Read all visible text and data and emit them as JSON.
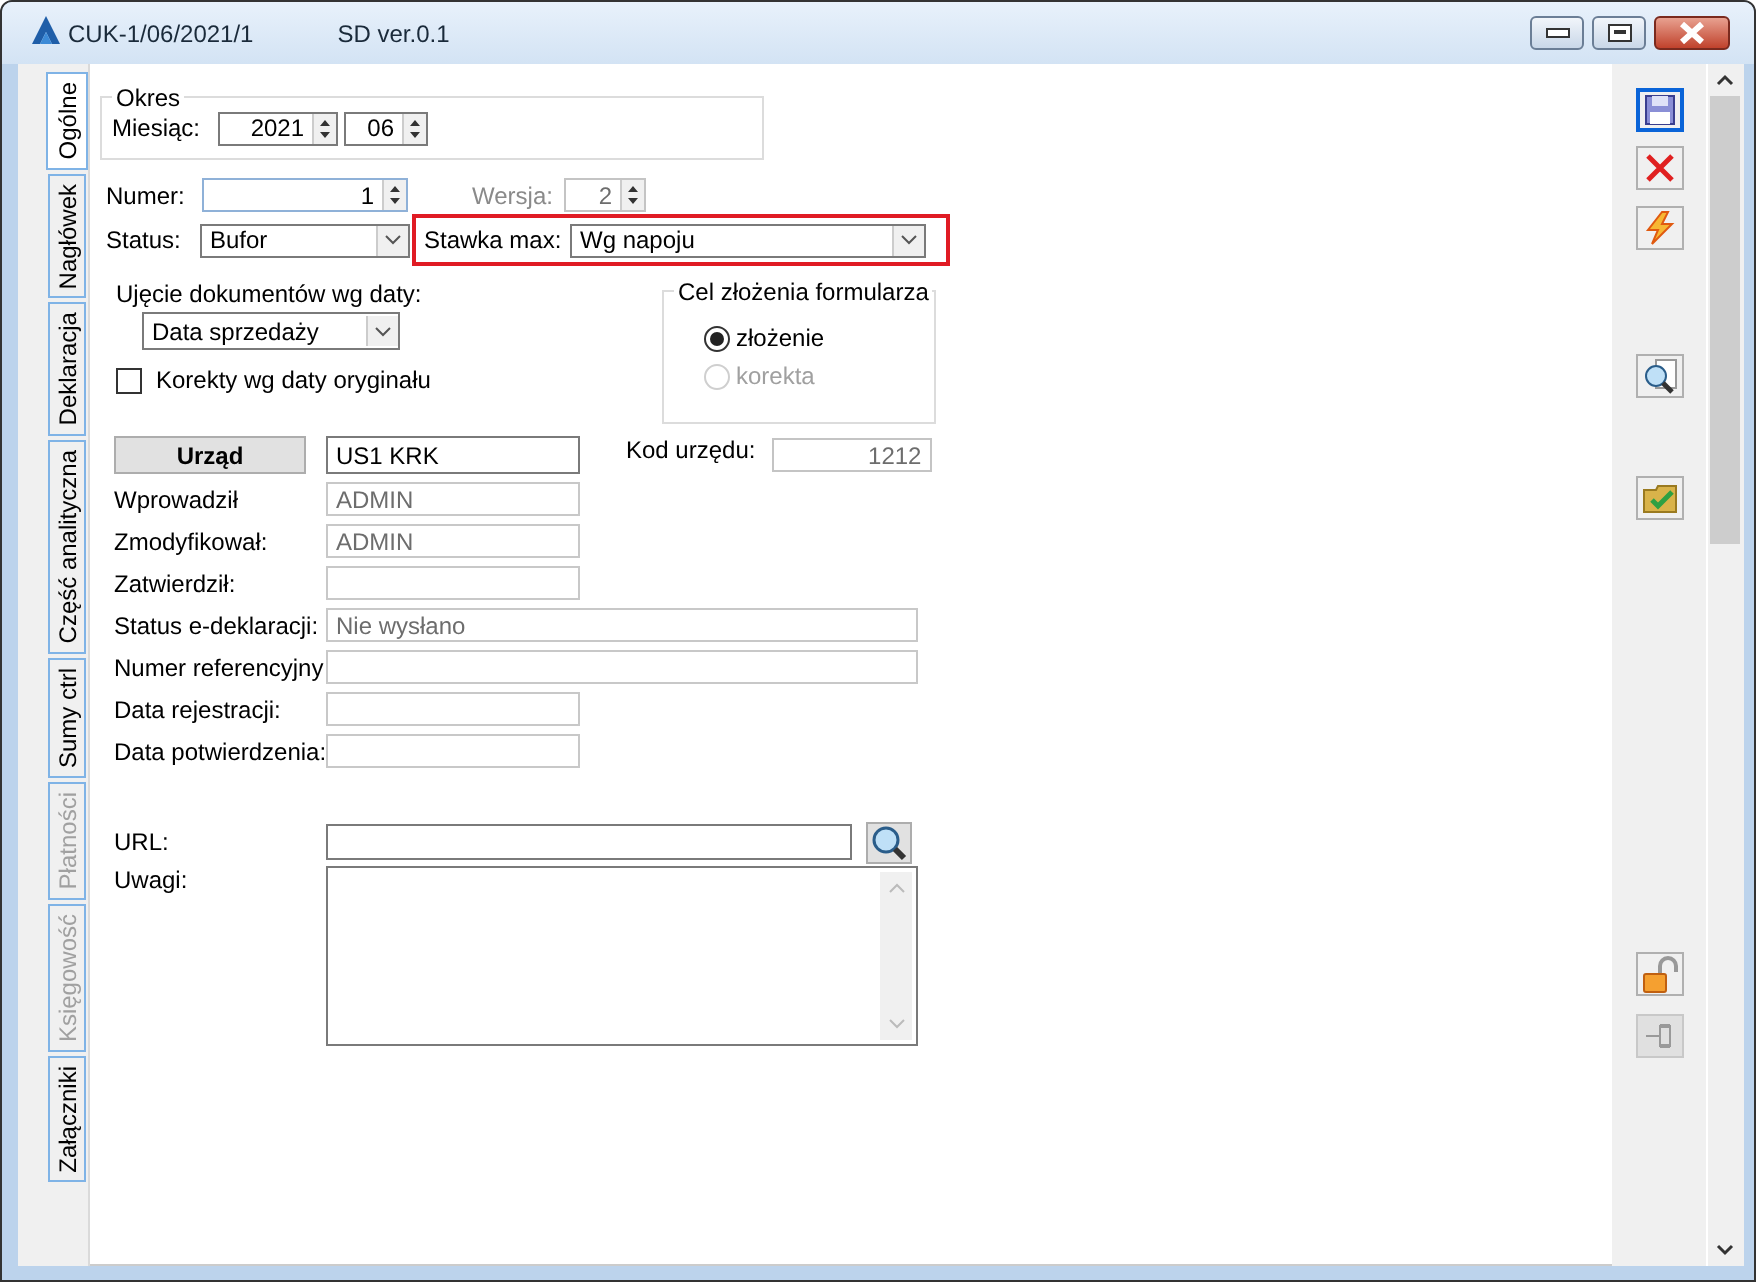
{
  "window": {
    "title": "CUK-1/06/2021/1",
    "subtitle": "SD ver.0.1"
  },
  "tabs": [
    {
      "label": "Ogólne",
      "selected": true,
      "disabled": false
    },
    {
      "label": "Nagłówek",
      "selected": false,
      "disabled": false
    },
    {
      "label": "Deklaracja",
      "selected": false,
      "disabled": false
    },
    {
      "label": "Część analityczna",
      "selected": false,
      "disabled": false
    },
    {
      "label": "Sumy ctrl",
      "selected": false,
      "disabled": false
    },
    {
      "label": "Płatności",
      "selected": false,
      "disabled": true
    },
    {
      "label": "Księgowość",
      "selected": false,
      "disabled": true
    },
    {
      "label": "Załączniki",
      "selected": false,
      "disabled": false
    }
  ],
  "period": {
    "legend": "Okres",
    "month_label": "Miesiąc:",
    "year": "2021",
    "month": "06"
  },
  "number": {
    "label": "Numer:",
    "value": "1"
  },
  "version": {
    "label": "Wersja:",
    "value": "2",
    "disabled": true
  },
  "status": {
    "label": "Status:",
    "value": "Bufor"
  },
  "max_rate": {
    "label": "Stawka max:",
    "value": "Wg napoju",
    "highlighted": true
  },
  "date_basis": {
    "label": "Ujęcie dokumentów wg daty:",
    "value": "Data sprzedaży"
  },
  "corrections": {
    "label": "Korekty wg daty oryginału",
    "checked": false
  },
  "purpose": {
    "legend": "Cel złożenia formularza",
    "options": [
      {
        "label": "złożenie",
        "selected": true,
        "disabled": false
      },
      {
        "label": "korekta",
        "selected": false,
        "disabled": true
      }
    ]
  },
  "office": {
    "button": "Urząd",
    "value": "US1 KRK",
    "code_label": "Kod urzędu:",
    "code": "1212"
  },
  "info_rows": [
    {
      "label": "Wprowadził",
      "value": "ADMIN",
      "kind": "short"
    },
    {
      "label": "Zmodyfikował:",
      "value": "ADMIN",
      "kind": "short"
    },
    {
      "label": "Zatwierdził:",
      "kind": "short"
    },
    {
      "label": "Status e-deklaracji:",
      "value": "Nie wysłano",
      "kind": "wide"
    },
    {
      "label": "Numer referencyjny",
      "kind": "wide"
    },
    {
      "label": "Data rejestracji:",
      "kind": "short"
    },
    {
      "label": "Data potwierdzenia:",
      "kind": "short"
    }
  ],
  "url": {
    "label": "URL:"
  },
  "notes": {
    "label": "Uwagi:"
  },
  "toolbar": [
    {
      "kind": "save",
      "selected": true,
      "disabled": false
    },
    {
      "kind": "delete",
      "selected": false,
      "disabled": false
    },
    {
      "kind": "lightning",
      "selected": false,
      "disabled": false
    },
    {
      "kind": "preview",
      "selected": false,
      "disabled": false
    },
    {
      "kind": "folder",
      "selected": false,
      "disabled": false
    },
    {
      "kind": "lock",
      "selected": false,
      "disabled": false
    },
    {
      "kind": "pin",
      "selected": false,
      "disabled": true
    }
  ]
}
